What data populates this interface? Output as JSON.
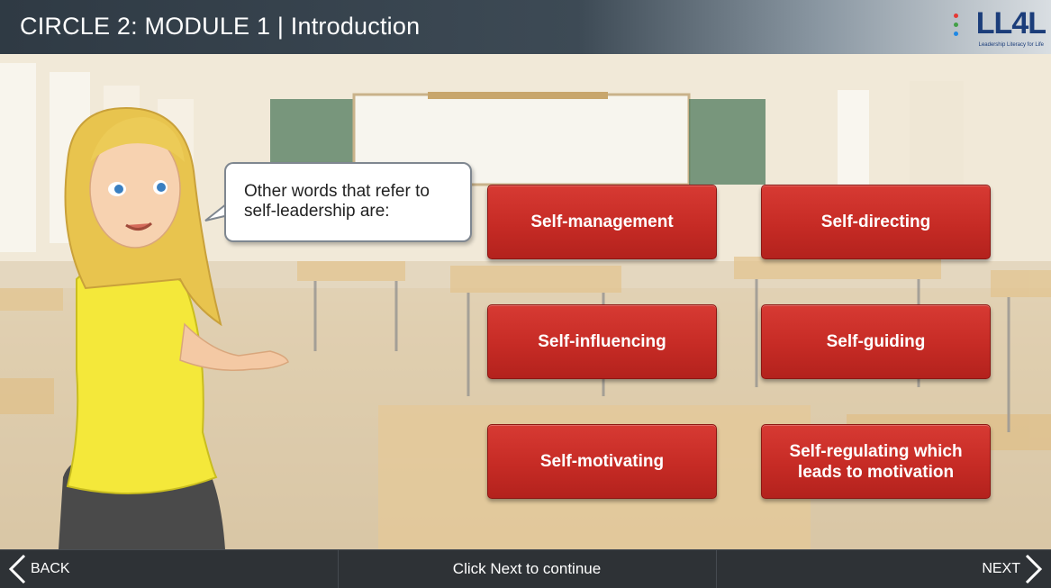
{
  "header": {
    "title": "CIRCLE 2: MODULE 1 | Introduction",
    "logo_text": "LL4L",
    "logo_tagline": "Leadership Literacy for Life",
    "logo_dot_colors": [
      "#e53935",
      "#43a047",
      "#fbc02d",
      "#1e88e5"
    ]
  },
  "bubble": {
    "text": "Other words that refer to self-leadership are:"
  },
  "terms": [
    {
      "label": "Self-management"
    },
    {
      "label": "Self-directing"
    },
    {
      "label": "Self-influencing"
    },
    {
      "label": "Self-guiding"
    },
    {
      "label": "Self-motivating"
    },
    {
      "label": "Self-regulating which leads to motivation"
    }
  ],
  "footer": {
    "back_label": "BACK",
    "center_text": "Click Next to continue",
    "next_label": "NEXT"
  },
  "colors": {
    "button_red": "#c62b25",
    "header_dark": "#2f3a44",
    "footer_bg": "#2e3236"
  }
}
